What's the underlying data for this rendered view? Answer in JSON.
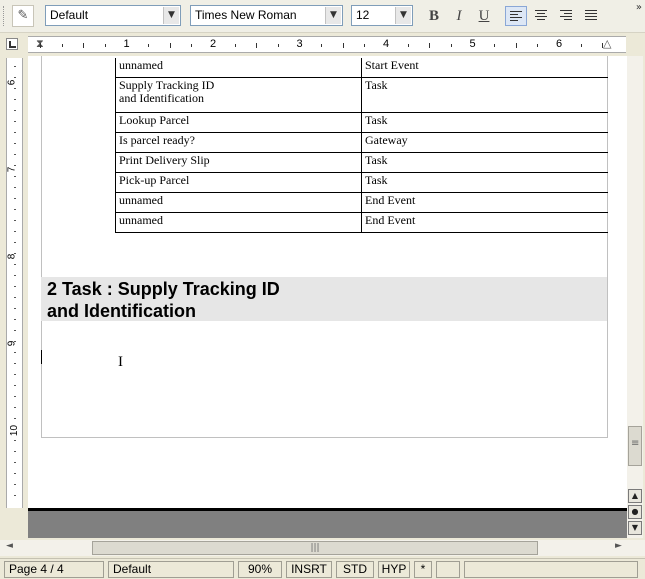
{
  "toolbar": {
    "style_value": "Default",
    "font_value": "Times New Roman",
    "size_value": "12",
    "bold_label": "B",
    "italic_label": "I",
    "underline_label": "U",
    "dropdown_glyph": "▼",
    "more_glyph": "»"
  },
  "ruler": {
    "numbers": [
      "1",
      "2",
      "3",
      "4",
      "5",
      "6"
    ],
    "vertical_numbers": [
      "6",
      "7",
      "8",
      "9",
      "10"
    ]
  },
  "table": {
    "rows": [
      {
        "name": "unnamed",
        "type": "Start Event"
      },
      {
        "name": "Supply Tracking ID\nand Identification",
        "type": "Task"
      },
      {
        "name": "Lookup Parcel",
        "type": "Task"
      },
      {
        "name": "Is parcel ready?",
        "type": "Gateway"
      },
      {
        "name": "Print Delivery Slip",
        "type": "Task"
      },
      {
        "name": "Pick-up Parcel",
        "type": "Task"
      },
      {
        "name": "unnamed",
        "type": "End Event"
      },
      {
        "name": "unnamed",
        "type": "End Event"
      }
    ]
  },
  "heading": {
    "text": "2 Task : Supply Tracking ID\n  and Identification"
  },
  "status": {
    "page": "Page 4 / 4",
    "style": "Default",
    "zoom": "90%",
    "insert_mode": "INSRT",
    "selection_mode": "STD",
    "hyphen": "HYP",
    "modified": "*"
  },
  "scroll": {
    "left_arrow": "◄",
    "right_arrow": "►",
    "grip": "|||"
  }
}
